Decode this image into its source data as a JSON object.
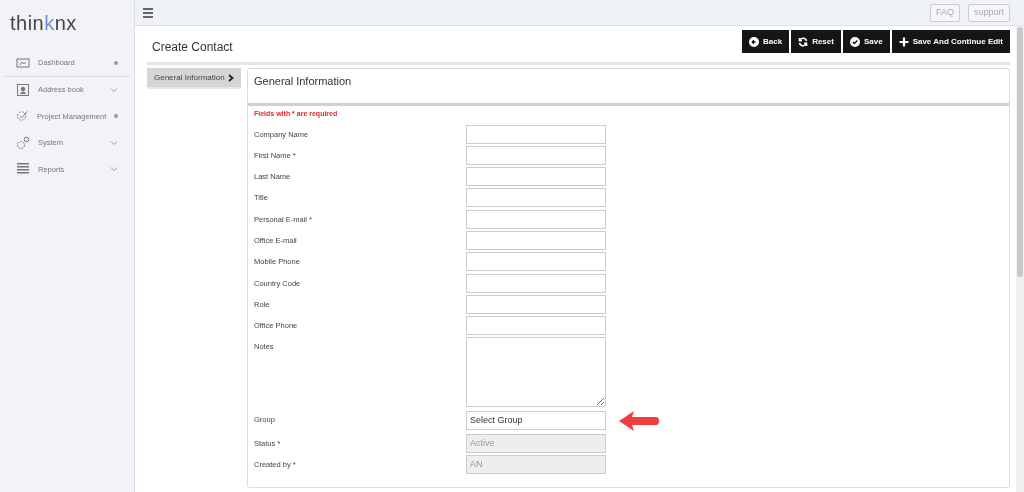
{
  "logo": {
    "first": "thin",
    "accent": "k",
    "last": "nx"
  },
  "sidebar": {
    "items": [
      {
        "label": "Dashboard"
      },
      {
        "label": "Address book"
      },
      {
        "label": "Project Management"
      },
      {
        "label": "System"
      },
      {
        "label": "Reports"
      }
    ]
  },
  "topbar": {
    "links": [
      "FAQ",
      "support"
    ]
  },
  "page": {
    "title": "Create Contact",
    "actions": [
      {
        "label": "Back"
      },
      {
        "label": "Reset"
      },
      {
        "label": "Save"
      },
      {
        "label": "Save And Continue Edit"
      }
    ],
    "tabs": [
      {
        "label": "General Information",
        "selected": true
      }
    ]
  },
  "panel": {
    "title": "General Information",
    "note": "Fields with * are required",
    "fields": [
      {
        "label": "Company Name",
        "kind": "text"
      },
      {
        "label": "First Name *",
        "kind": "text"
      },
      {
        "label": "Last Name",
        "kind": "text"
      },
      {
        "label": "Title",
        "kind": "text"
      },
      {
        "label": "Personal E-mail *",
        "kind": "text"
      },
      {
        "label": "Office E-mail",
        "kind": "text"
      },
      {
        "label": "Mobile Phone",
        "kind": "text"
      },
      {
        "label": "Country Code",
        "kind": "text"
      },
      {
        "label": "Role",
        "kind": "text"
      },
      {
        "label": "Office Phone",
        "kind": "text"
      },
      {
        "label": "Notes",
        "kind": "textarea"
      },
      {
        "label": "Group",
        "kind": "select",
        "value": "Select Group"
      },
      {
        "label": "Status *",
        "kind": "disabled",
        "value": "Active"
      },
      {
        "label": "Created by *",
        "kind": "disabled",
        "value": "AN"
      }
    ]
  }
}
